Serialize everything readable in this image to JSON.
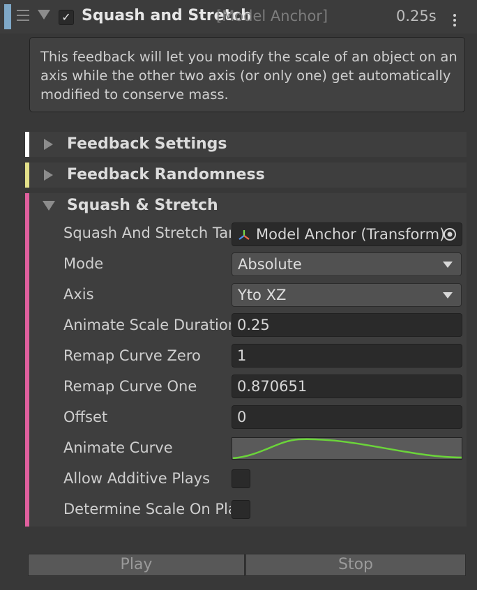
{
  "header": {
    "title": "Squash and Stretch",
    "target": "[Model Anchor]",
    "duration": "0.25s",
    "enabled_mark": "✓",
    "accent_color": "#7fa8c7"
  },
  "help": {
    "text": "This feedback will let you modify the scale of an object on an axis while the other two axis (or only one) get automatically modified to conserve mass."
  },
  "sections": [
    {
      "label": "Feedback Settings",
      "color": "#ffffff",
      "expanded": false
    },
    {
      "label": "Feedback Randomness",
      "color": "#e3e08a",
      "expanded": false
    },
    {
      "label": "Squash & Stretch",
      "color": "#e0609e",
      "expanded": true
    }
  ],
  "properties": {
    "target": {
      "label": "Squash And Stretch Target",
      "value": "Model Anchor (Transform)",
      "icon": "transform-icon"
    },
    "mode": {
      "label": "Mode",
      "value": "Absolute"
    },
    "axis": {
      "label": "Axis",
      "value": "Yto XZ"
    },
    "animate_scale_duration": {
      "label": "Animate Scale Duration",
      "value": "0.25"
    },
    "remap_curve_zero": {
      "label": "Remap Curve Zero",
      "value": "1"
    },
    "remap_curve_one": {
      "label": "Remap Curve One",
      "value": "0.870651"
    },
    "offset": {
      "label": "Offset",
      "value": "0"
    },
    "animate_curve": {
      "label": "Animate Curve",
      "curve_color": "#6bd43a"
    },
    "allow_additive_plays": {
      "label": "Allow Additive Plays",
      "checked": false
    },
    "determine_scale_on_play": {
      "label": "Determine Scale On Play",
      "checked": false
    }
  },
  "buttons": {
    "play": "Play",
    "stop": "Stop"
  }
}
